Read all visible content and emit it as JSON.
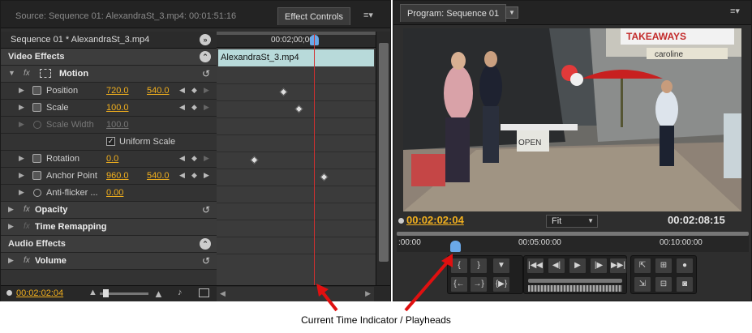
{
  "left_panel": {
    "tabs": {
      "source": "Source: Sequence 01: AlexandraSt_3.mp4: 00:01:51:16",
      "effect_controls": "Effect Controls"
    },
    "sequence_label": "Sequence 01 * AlexandraSt_3.mp4",
    "timeline_time": "00:02;00;00",
    "clip_name": "AlexandraSt_3.mp4",
    "video_effects": "Video Effects",
    "motion": "Motion",
    "position": {
      "label": "Position",
      "x": "720.0",
      "y": "540.0"
    },
    "scale": {
      "label": "Scale",
      "value": "100.0"
    },
    "scale_width": {
      "label": "Scale Width",
      "value": "100.0"
    },
    "uniform_scale": "Uniform Scale",
    "rotation": {
      "label": "Rotation",
      "value": "0.0"
    },
    "anchor_point": {
      "label": "Anchor Point",
      "x": "960.0",
      "y": "540.0"
    },
    "anti_flicker": {
      "label": "Anti-flicker ...",
      "value": "0.00"
    },
    "opacity": "Opacity",
    "time_remapping": "Time Remapping",
    "audio_effects": "Audio Effects",
    "volume": "Volume",
    "current_time": "00:02:02:04"
  },
  "right_panel": {
    "tab": "Program: Sequence 01",
    "timecode_current": "00:02:02:04",
    "timecode_duration": "00:02:08:15",
    "zoom": "Fit",
    "ruler_labels": [
      ":00:00",
      "00:05:00:00",
      "00:10:00:00"
    ],
    "scene_text": {
      "sign1": "TAKEAWAYS",
      "sign2": "caroline",
      "sign3": "OPEN"
    }
  },
  "annotation": "Current Time Indicator / Playheads",
  "colors": {
    "accent": "#f2b01e",
    "cti": "#d23030",
    "panel": "#2e2e2e",
    "arrow": "#e01010"
  }
}
